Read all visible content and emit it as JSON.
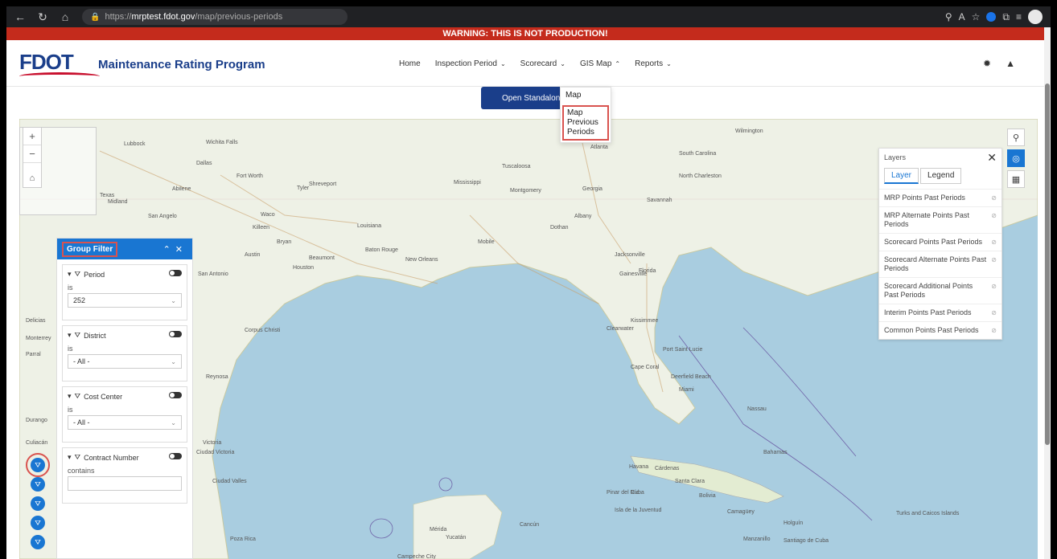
{
  "browser": {
    "url_scheme": "https://",
    "url_host": "mrptest.fdot.gov",
    "url_path": "/map/previous-periods",
    "back": "←",
    "refresh": "↻",
    "home": "⌂"
  },
  "warning": "WARNING: THIS IS NOT PRODUCTION!",
  "header": {
    "logo": "FDOT",
    "app_title": "Maintenance Rating Program",
    "nav": [
      {
        "label": "Home",
        "chev": ""
      },
      {
        "label": "Inspection Period",
        "chev": "⌄"
      },
      {
        "label": "Scorecard",
        "chev": "⌄"
      },
      {
        "label": "GIS Map",
        "chev": "⌃"
      },
      {
        "label": "Reports",
        "chev": "⌄"
      }
    ]
  },
  "standalone_button": "Open Standalone Map",
  "gis_dropdown": [
    "Map",
    "Map Previous Periods"
  ],
  "layers_panel": {
    "title": "Layers",
    "tabs": [
      "Layer",
      "Legend"
    ],
    "items": [
      "MRP Points Past Periods",
      "MRP Alternate Points Past Periods",
      "Scorecard Points Past Periods",
      "Scorecard Alternate Points Past Periods",
      "Scorecard Additional Points Past Periods",
      "Interim Points Past Periods",
      "Common Points Past Periods"
    ]
  },
  "group_filter": {
    "title": "Group Filter",
    "filters": [
      {
        "label": "Period",
        "op": "is",
        "value": "252"
      },
      {
        "label": "District",
        "op": "is",
        "value": "- All -"
      },
      {
        "label": "Cost Center",
        "op": "is",
        "value": "- All -"
      },
      {
        "label": "Contract Number",
        "op": "contains",
        "value": ""
      }
    ]
  },
  "map_labels": [
    {
      "text": "Lubbock"
    },
    {
      "text": "Fort Worth"
    },
    {
      "text": "Dallas"
    },
    {
      "text": "Midland"
    },
    {
      "text": "Abilene"
    },
    {
      "text": "San Angelo"
    },
    {
      "text": "Waco"
    },
    {
      "text": "Killeen"
    },
    {
      "text": "Austin"
    },
    {
      "text": "Bryan"
    },
    {
      "text": "San Antonio"
    },
    {
      "text": "Houston"
    },
    {
      "text": "Beaumont"
    },
    {
      "text": "Corpus Christi"
    },
    {
      "text": "Reynosa"
    },
    {
      "text": "Victoria"
    },
    {
      "text": "Shreveport"
    },
    {
      "text": "Tyler"
    },
    {
      "text": "Louisiana"
    },
    {
      "text": "Baton Rouge"
    },
    {
      "text": "New Orleans"
    },
    {
      "text": "Mobile"
    },
    {
      "text": "Mississippi"
    },
    {
      "text": "Tuscaloosa"
    },
    {
      "text": "Montgomery"
    },
    {
      "text": "Atlanta"
    },
    {
      "text": "Georgia"
    },
    {
      "text": "Albany"
    },
    {
      "text": "Dothan"
    },
    {
      "text": "Savannah"
    },
    {
      "text": "North Charleston"
    },
    {
      "text": "South Carolina"
    },
    {
      "text": "Wilmington"
    },
    {
      "text": "Jacksonville"
    },
    {
      "text": "Gainesville"
    },
    {
      "text": "Florida"
    },
    {
      "text": "Kissimmee"
    },
    {
      "text": "Clearwater"
    },
    {
      "text": "Port Saint Lucie"
    },
    {
      "text": "Cape Coral"
    },
    {
      "text": "Deerfield Beach"
    },
    {
      "text": "Miami"
    },
    {
      "text": "Nassau"
    },
    {
      "text": "Bahamas"
    },
    {
      "text": "Havana"
    },
    {
      "text": "Cárdenas"
    },
    {
      "text": "Santa Clara"
    },
    {
      "text": "Cuba"
    },
    {
      "text": "Camagüey"
    },
    {
      "text": "Holguín"
    },
    {
      "text": "Santiago de Cuba"
    },
    {
      "text": "Turks and Caicos Islands"
    },
    {
      "text": "Mérida"
    },
    {
      "text": "Cancún"
    },
    {
      "text": "Campeche City"
    },
    {
      "text": "Yucatán"
    },
    {
      "text": "Pinar del Río"
    },
    {
      "text": "Isla de la Juventud"
    },
    {
      "text": "Bolivia"
    },
    {
      "text": "Manzanillo"
    },
    {
      "text": "Durango"
    },
    {
      "text": "Culiacán"
    },
    {
      "text": "Monterrey"
    },
    {
      "text": "Ciudad Victoria"
    },
    {
      "text": "Poza Rica"
    },
    {
      "text": "Delicias"
    },
    {
      "text": "Parral"
    },
    {
      "text": "Ciudad Valles"
    },
    {
      "text": "Texas"
    },
    {
      "text": "Wichita Falls"
    }
  ]
}
